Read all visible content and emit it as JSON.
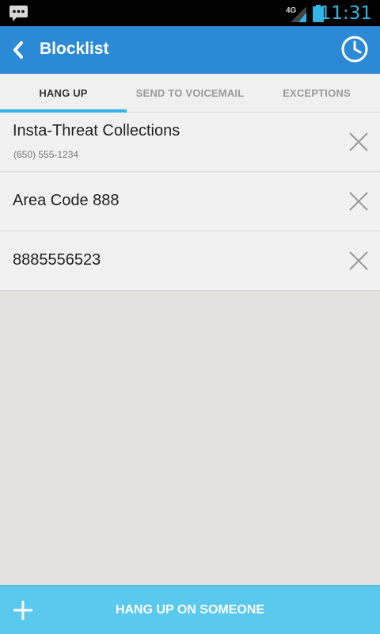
{
  "status_bar": {
    "network": "4G",
    "time": "11:31",
    "accent_color": "#33b5e5"
  },
  "action_bar": {
    "title": "Blocklist",
    "color": "#2b89d6"
  },
  "tabs": [
    {
      "label": "HANG UP",
      "active": true
    },
    {
      "label": "SEND TO VOICEMAIL",
      "active": false
    },
    {
      "label": "EXCEPTIONS",
      "active": false
    }
  ],
  "blocklist": [
    {
      "name": "Insta-Threat Collections",
      "number": "(650) 555-1234"
    },
    {
      "name": "Area Code 888"
    },
    {
      "name": "8885556523"
    }
  ],
  "bottom_button": {
    "label": "HANG UP ON SOMEONE",
    "color": "#5ac8ef"
  },
  "icons": {
    "notification": "message-notification-icon",
    "signal": "signal-4g-icon",
    "battery": "battery-icon",
    "back": "back-chevron-icon",
    "history": "clock-icon",
    "remove": "close-icon",
    "add": "plus-icon"
  }
}
